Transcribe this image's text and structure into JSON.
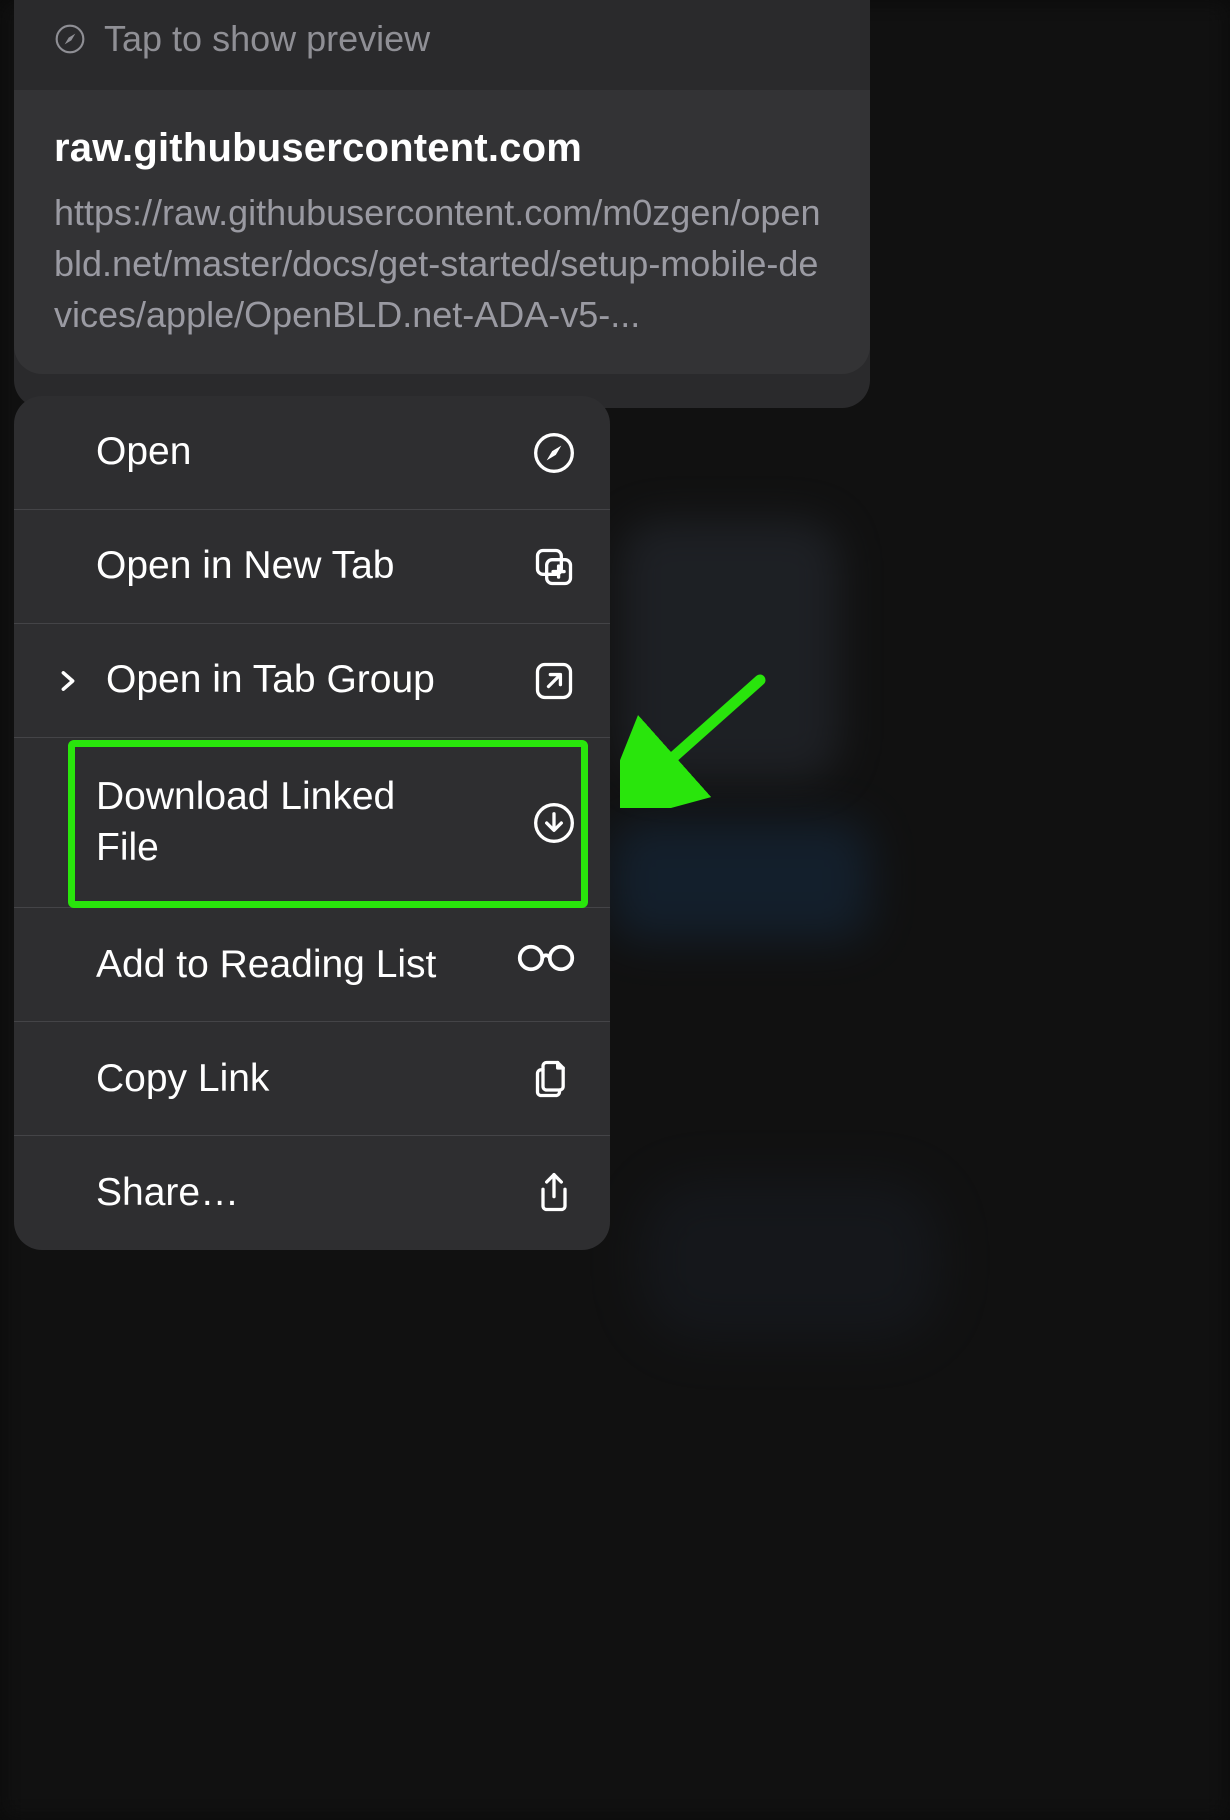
{
  "preview": {
    "tap_label": "Tap to show preview",
    "domain": "raw.githubusercontent.com",
    "url": "https://raw.githubusercontent.com/m0zgen/openbld.net/master/docs/get-started/setup-mobile-devices/apple/OpenBLD.net-ADA-v5-..."
  },
  "menu": {
    "open": "Open",
    "open_new_tab": "Open in New Tab",
    "open_tab_group": "Open in Tab Group",
    "download": "Download Linked File",
    "reading_list": "Add to Reading List",
    "copy_link": "Copy Link",
    "share": "Share…"
  },
  "highlight": {
    "color": "#29e50c"
  }
}
